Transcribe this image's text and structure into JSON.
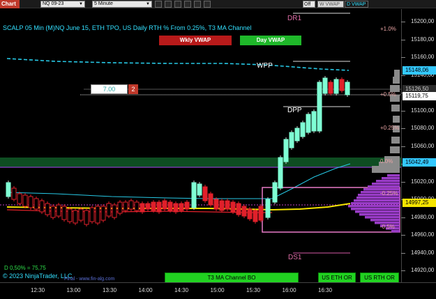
{
  "toolbar": {
    "tab_label": "Chart",
    "instrument": "NQ 09-23",
    "interval": "5 Minute",
    "off_label": "Off",
    "buttons": [
      "W VWAP",
      "D VWAP"
    ]
  },
  "chart": {
    "title": "SCALP 05 Min (M)NQ June 15, ETH TPO, US Daily RTH % From 0.25%, T3 MA Channel",
    "weekly_vwap": "Wkly VWAP",
    "daily_vwap": "Day VWAP",
    "labels": {
      "dr1": "DR1",
      "wpp": "WPP",
      "dpp": "DPP",
      "ds1": "DS1"
    },
    "pct_labels": [
      "+1.0%",
      "+0.5%",
      "+0.25%",
      "0.0%",
      "-0.25%",
      "-0.5%"
    ],
    "input_value": "7.00",
    "input_badge": "2",
    "stat": "D 0,50% = 75,75",
    "copyright": "© 2023 NinjaTrader, LLC",
    "watermark": "Final - www.fin-alg.com",
    "bottom_buttons": [
      "T3 MA Channel BO",
      "US ETH OR",
      "US RTH OR"
    ]
  },
  "y_axis": {
    "ticks": [
      "15200,00",
      "15180,00",
      "15160,00",
      "15140,00",
      "15120,00",
      "15100,00",
      "15080,00",
      "15060,00",
      "15040,00",
      "15020,00",
      "15000,00",
      "14980,00",
      "14960,00",
      "14940,00",
      "14920,00"
    ],
    "badges": [
      {
        "text": "15148,06",
        "bg": "#33c8ff",
        "fg": "#000"
      },
      {
        "text": "15126,50",
        "bg": "#2b2b2b",
        "fg": "#ccc"
      },
      {
        "text": "15119,75",
        "bg": "#ffffff",
        "fg": "#000"
      },
      {
        "text": "15042,49",
        "bg": "#33c8ff",
        "fg": "#000"
      },
      {
        "text": "14997,25",
        "bg": "#f5e400",
        "fg": "#000"
      }
    ]
  },
  "x_axis": {
    "ticks": [
      "12:30",
      "13:00",
      "13:30",
      "14:00",
      "14:30",
      "15:00",
      "15:30",
      "16:00",
      "16:30"
    ]
  },
  "colors": {
    "up": "#7fffd4",
    "down": "#e0202a",
    "vwap": "#27c9e6",
    "profile": "#9a3cc8",
    "ma": "#f5e400",
    "green_zone": "#0e4d22"
  }
}
